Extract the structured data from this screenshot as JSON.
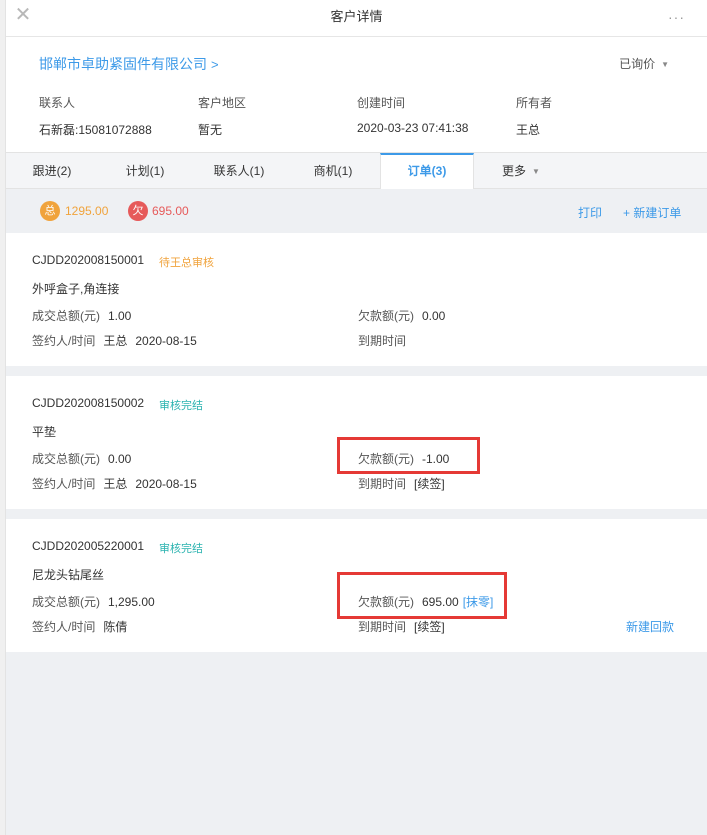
{
  "window": {
    "title": "客户详情"
  },
  "customer": {
    "name": "邯郸市卓助紧固件有限公司",
    "status": "已询价",
    "fields": [
      {
        "label": "联系人",
        "value": "石新磊:15081072888"
      },
      {
        "label": "客户地区",
        "value": "暂无"
      },
      {
        "label": "创建时间",
        "value": "2020-03-23 07:41:38"
      },
      {
        "label": "所有者",
        "value": "王总"
      }
    ]
  },
  "tabs": [
    {
      "label": "跟进(2)"
    },
    {
      "label": "计划(1)"
    },
    {
      "label": "联系人(1)"
    },
    {
      "label": "商机(1)"
    },
    {
      "label": "订单(3)"
    },
    {
      "label": "更多"
    }
  ],
  "summary": {
    "total_badge": "总",
    "total_value": "1295.00",
    "owe_badge": "欠",
    "owe_value": "695.00",
    "print_label": "打印",
    "new_order_label": "+ 新建订单"
  },
  "labels": {
    "total_amount": "成交总额(元)",
    "owe_amount": "欠款额(元)",
    "signer": "签约人/时间",
    "due": "到期时间",
    "renew": "[续签]",
    "wipe": "[抹零]",
    "new_payment": "新建回款"
  },
  "colors": {
    "accent": "#3d9ae8",
    "pending": "#f0a33c",
    "done": "#2bb3b0",
    "owe": "#e65a5a",
    "highlight": "#e53935"
  },
  "orders": [
    {
      "code": "CJDD202008150001",
      "status": "待王总审核",
      "product": "外呼盒子,角连接",
      "total": "1.00",
      "owe": "0.00",
      "signer": "王总",
      "date": "2020-08-15"
    },
    {
      "code": "CJDD202008150002",
      "status": "审核完结",
      "product": "平垫",
      "total": "0.00",
      "owe": "-1.00",
      "signer": "王总",
      "date": "2020-08-15"
    },
    {
      "code": "CJDD202005220001",
      "status": "审核完结",
      "product": "尼龙头钻尾丝",
      "total": "1,295.00",
      "owe": "695.00",
      "signer": "陈倩",
      "date": ""
    }
  ]
}
